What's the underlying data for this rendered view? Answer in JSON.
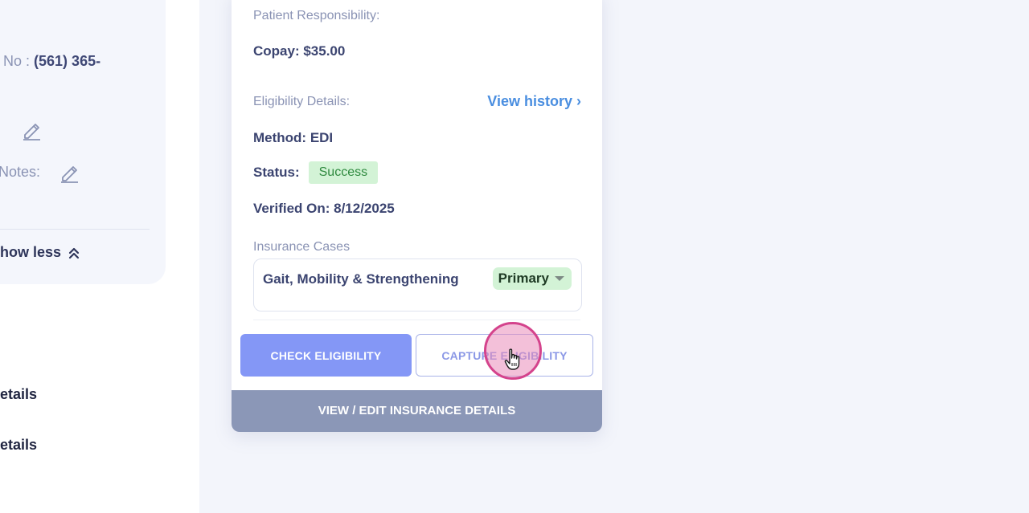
{
  "left_panel": {
    "phone_label": "No :",
    "phone_value": "(561) 365-",
    "field_label_1": ":",
    "notes_label": "Notes:",
    "show_less": "how less",
    "detail_1": "etails",
    "detail_2": "etails"
  },
  "insurance_card": {
    "patient_responsibility_label": "Patient Responsibility:",
    "copay": "Copay: $35.00",
    "eligibility_details_label": "Eligibility Details:",
    "view_history": "View history",
    "view_history_chevron": "›",
    "method": "Method: EDI",
    "status_label": "Status:",
    "status_value": "Success",
    "verified_on": "Verified On: 8/12/2025",
    "insurance_cases_label": "Insurance Cases",
    "case_name": "Gait, Mobility & Strengthening",
    "case_priority": "Primary",
    "check_eligibility": "CHECK ELIGIBILITY",
    "capture_eligibility": "CAPTURE ELIGIBILITY",
    "view_edit": "VIEW / EDIT INSURANCE DETAILS"
  },
  "colors": {
    "accent_blue": "#8497f6",
    "link_blue": "#4a8ee0",
    "success_bg": "#d3f3d6",
    "success_text": "#2f8a3f",
    "bottom_bar": "#8b97b7",
    "click_highlight": "#d4438c"
  },
  "icons": [
    "pencil-icon",
    "double-chevron-up-icon",
    "caret-down-icon",
    "hand-pointer-icon"
  ]
}
